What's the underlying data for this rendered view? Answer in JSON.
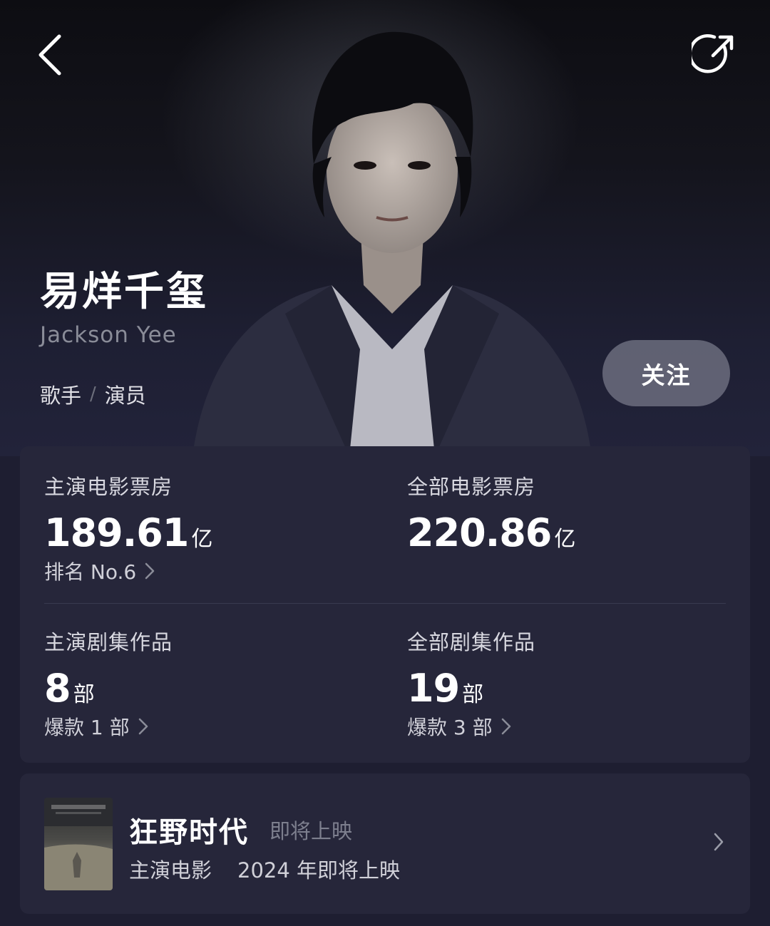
{
  "profile": {
    "name": "易烊千玺",
    "en_name": "Jackson Yee",
    "role_1": "歌手",
    "role_sep": "/",
    "role_2": "演员",
    "follow_label": "关注"
  },
  "stats": {
    "lead_box_office": {
      "label": "主演电影票房",
      "value": "189.61",
      "unit": "亿",
      "sub": "排名 No.6"
    },
    "all_box_office": {
      "label": "全部电影票房",
      "value": "220.86",
      "unit": "亿"
    },
    "lead_series": {
      "label": "主演剧集作品",
      "value": "8",
      "unit": "部",
      "sub": "爆款 1 部"
    },
    "all_series": {
      "label": "全部剧集作品",
      "value": "19",
      "unit": "部",
      "sub": "爆款 3 部"
    }
  },
  "upcoming_movie": {
    "title": "狂野时代",
    "status": "即将上映",
    "role": "主演电影",
    "release": "2024 年即将上映"
  },
  "icons": {
    "back": "back-arrow-icon",
    "share": "share-icon",
    "chevron": "chevron-right-icon"
  },
  "colors": {
    "background": "#1e1e31",
    "card": "#26263a",
    "follow_button": "#8a8c9a",
    "muted_text": "#8a8c98"
  }
}
